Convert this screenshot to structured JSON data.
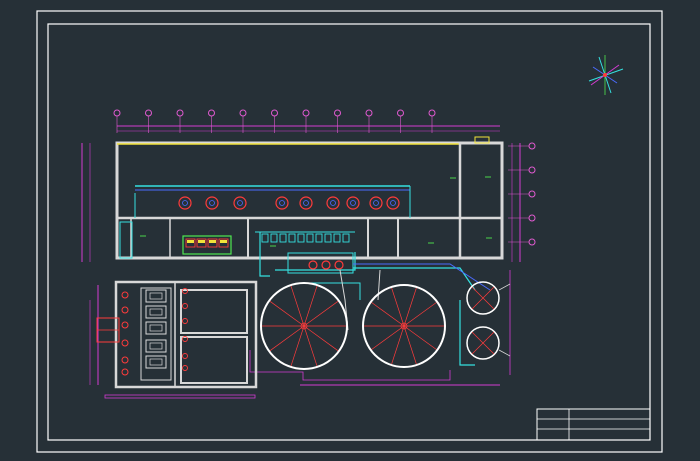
{
  "drawing": {
    "type": "CAD plant layout drawing",
    "background_color": "#263037",
    "colors": {
      "border": "#ffffff",
      "building_wall": "#d8d8d8",
      "cyan_pipe": "#35e0e0",
      "magenta_dim": "#d23bd2",
      "yellow": "#f2e33a",
      "green": "#4fe84f",
      "red": "#ff3b3b",
      "blue": "#4b6bff",
      "grid_bubble": "#e05ad0"
    },
    "icons": [
      "north-arrow-icon",
      "grid-bubble-icon",
      "circular-tank-icon",
      "round-vessel-icon"
    ],
    "title_block": {
      "rows": 3,
      "text": ""
    }
  }
}
